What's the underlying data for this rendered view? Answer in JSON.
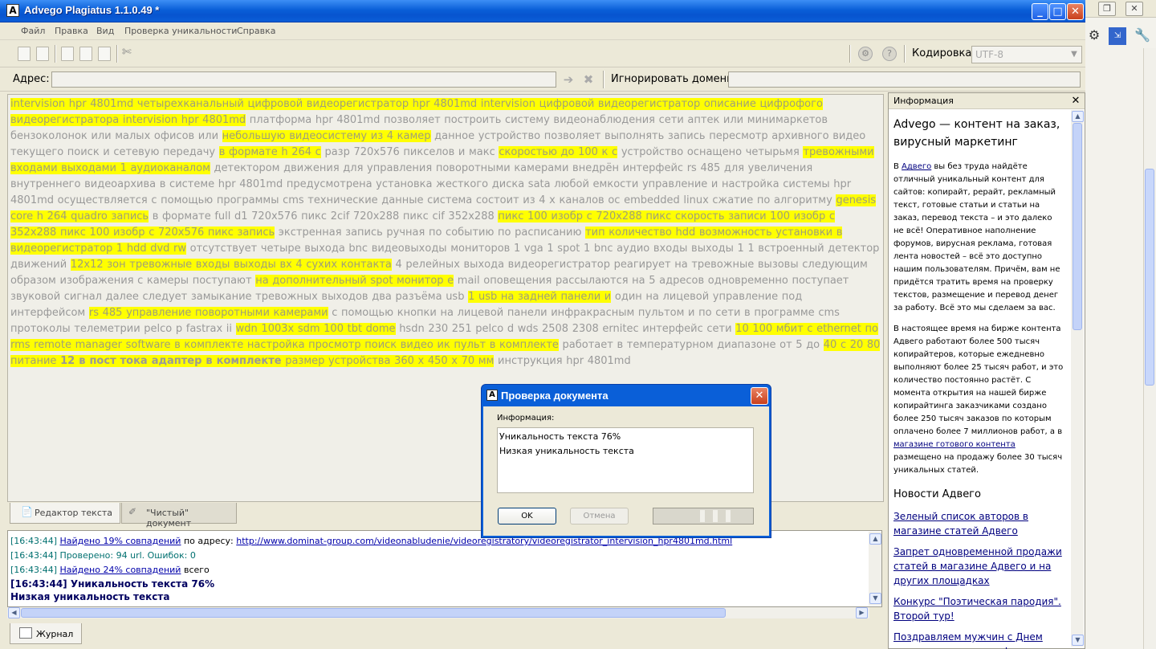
{
  "window": {
    "title": "Advego Plagiatus 1.1.0.49 *",
    "app_icon": "A"
  },
  "menu": [
    "Файл",
    "Правка",
    "Вид",
    "Проверка уникальности",
    "Справка"
  ],
  "toolbar": {
    "encoding_label": "Кодировка:",
    "encoding_value": "UTF-8"
  },
  "address": {
    "label": "Адрес:",
    "value": "",
    "ignore_label": "Игнорировать домены:",
    "ignore_value": ""
  },
  "editor": {
    "segments": [
      {
        "t": "intervision hpr 4801md четырехканальный цифровой видеорегистратор hpr 4801md intervision цифровой видеорегистратор описание цифрофого видеорегистратора intervision hpr 4801md",
        "hl": true
      },
      {
        "t": " платформа hpr 4801md позволяет построить систему видеонаблюдения сети аптек или минимаркетов бензоколонок или малых офисов или ",
        "hl": false
      },
      {
        "t": "небольшую видеосистему из 4 камер",
        "hl": true
      },
      {
        "t": " данное устройство позволяет выполнять запись пересмотр архивного видео текущего поиск и сетевую передачу ",
        "hl": false
      },
      {
        "t": "в формате h 264 с",
        "hl": true
      },
      {
        "t": " разр 720x576 пикселов и макс ",
        "hl": false
      },
      {
        "t": "скоростью до 100 к с",
        "hl": true
      },
      {
        "t": " устройство оснащено четырьмя ",
        "hl": false
      },
      {
        "t": "тревожными входами выходами 1 аудиоканалом",
        "hl": true
      },
      {
        "t": " детектором движения для управления поворотными камерами внедрён интерфейс rs 485 для увеличения внутреннего видеоархива в системе hpr 4801md предусмотрена установка жесткого диска sata любой емкости управление и настройка системы hpr 4801md осуществляется с помощью программы cms технические данные система состоит из 4 х каналов ос embedded linux сжатие по алгоритму ",
        "hl": false
      },
      {
        "t": "genesis core h 264 quadro запись",
        "hl": true
      },
      {
        "t": " в формате full d1 720x576 пикс 2cif 720x288 пикс cif 352x288 ",
        "hl": false
      },
      {
        "t": "пикс 100 изобр с 720x288 пикс скорость записи 100 изобр с 352x288 пикс 100 изобр с 720x576 пикс запись",
        "hl": true
      },
      {
        "t": " экстренная запись ручная по событию по расписанию ",
        "hl": false
      },
      {
        "t": "тип количество hdd возможность установки в видеорегистратор 1 hdd dvd rw",
        "hl": true
      },
      {
        "t": " отсутствует четыре выхода bnc видеовыходы мониторов 1 vga 1 spot 1 bnc аудио входы выходы 1 1 встроенный детектор движений ",
        "hl": false
      },
      {
        "t": "12x12 зон тревожные входы выходы вх 4 сухих контакта",
        "hl": true
      },
      {
        "t": " 4 релейных выхода видеорегистратор реагирует на тревожные вызовы следующим образом изображения с камеры поступают ",
        "hl": false
      },
      {
        "t": "на дополнительный spot монитор e",
        "hl": true
      },
      {
        "t": " mail оповещения рассылаются на 5 адресов одновременно поступает звуковой сигнал далее следует замыкание тревожных выходов два разъёма usb ",
        "hl": false
      },
      {
        "t": "1 usb на задней панели и",
        "hl": true
      },
      {
        "t": " один на лицевой управление под интерфейсом ",
        "hl": false
      },
      {
        "t": "rs 485 управление поворотными камерами",
        "hl": true
      },
      {
        "t": " с помощью кнопки на лицевой панели инфракрасным пультом и по сети в программе cms протоколы телеметрии pelco p fastrax ii ",
        "hl": false
      },
      {
        "t": "wdn 1003x sdm 100 tbt dome",
        "hl": true
      },
      {
        "t": " hsdn 230 251 pelco d wds 2508 2308 ernitec интерфейс сети ",
        "hl": false
      },
      {
        "t": "10 100 мбит с ethernet по rms remote manager software в комплекте настройка просмотр поиск видео ик пульт в комплекте",
        "hl": true
      },
      {
        "t": " работает в температурном диапазоне от 5 до ",
        "hl": false
      },
      {
        "t": "40 с 20 80 питание ",
        "hl": true
      },
      {
        "t": "12 в пост тока адаптер в комплекте",
        "hl": true,
        "bold": true
      },
      {
        "t": " размер устройства 360 x 450 x 70 мм",
        "hl": true
      },
      {
        "t": " инструкция hpr 4801md",
        "hl": false
      }
    ]
  },
  "editor_tabs": [
    {
      "label": "Редактор текста"
    },
    {
      "label": "\"Чистый\" документ"
    }
  ],
  "log": {
    "lines": [
      {
        "ts": "[16:43:44]",
        "link": "Найдено 19% совпадений",
        "mid": " по адресу: ",
        "url": "http://www.dominat-group.com/videonabludenie/videoregistratory/videoregistrator_intervision_hpr4801md.html"
      },
      {
        "ts": "[16:43:44]",
        "text": "Проверено: 94 url. Ошибок: 0"
      },
      {
        "ts": "[16:43:44]",
        "link": "Найдено 24% совпадений",
        "mid": " всего"
      }
    ],
    "bold_line1": "[16:43:44] Уникальность текста 76%",
    "bold_line2": "Низкая уникальность текста"
  },
  "journal_tab": "Журнал",
  "info_panel": {
    "header": "Информация",
    "title": "Advego — контент на заказ, вирусный маркетинг",
    "p1_before": "В ",
    "p1_link": "Адвего",
    "p1_after": " вы без труда найдёте отличный уникальный контент для сайтов: копирайт, рерайт, рекламный текст, готовые статьи и статьи на заказ, перевод текста – и это далеко не всё! Оперативное наполнение форумов, вирусная реклама, готовая лента новостей – всё это доступно нашим пользователям. Причём, вам не придётся тратить время на проверку текстов, размещение и перевод денег за работу. Всё это мы сделаем за вас.",
    "p2_before": "В настоящее время на бирже контента Адвего работают более 500 тысяч копирайтеров, которые ежедневно выполняют более 25 тысяч работ, и это количество постоянно растёт. С момента открытия на нашей бирже копирайтинга заказчиками создано более 250 тысяч заказов по которым оплачено более 7 миллионов работ, а в ",
    "p2_link": "магазине готового контента",
    "p2_after": " размещено на продажу более 30 тысяч уникальных статей.",
    "news_title": "Новости Адвего",
    "news": [
      "Зеленый список авторов в магазине статей Адвего",
      "Запрет одновременной продажи статей в магазине Адвего и на других площадках",
      "Конкурс \"Поэтическая пародия\". Второй тур!",
      "Поздравляем мужчин с Днем защитника отечества! Специальные марки!"
    ]
  },
  "dialog": {
    "title": "Проверка документа",
    "info_label": "Информация:",
    "line1": "Уникальность текста 76%",
    "line2": "Низкая уникальность текста",
    "ok": "OK",
    "cancel": "Отмена"
  }
}
